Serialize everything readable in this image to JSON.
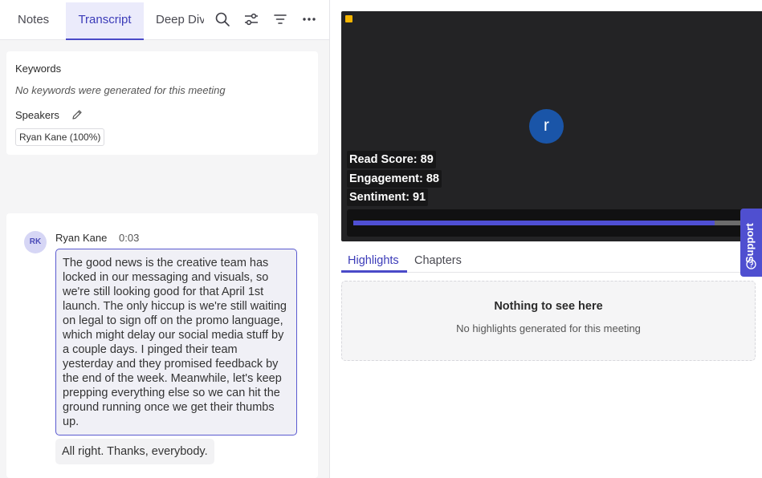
{
  "tabs": {
    "notes": "Notes",
    "transcript": "Transcript",
    "deep_dive": "Deep Dive"
  },
  "toolbar_icons": [
    "search-icon",
    "sliders-icon",
    "filter-icon",
    "more-icon"
  ],
  "keywords": {
    "title": "Keywords",
    "empty": "No keywords were generated for this meeting"
  },
  "speakers": {
    "title": "Speakers",
    "chips": [
      "Ryan Kane (100%)"
    ]
  },
  "transcript": {
    "initials": "RK",
    "speaker": "Ryan Kane",
    "time": "0:03",
    "segment1": "The good news is the creative team has locked in our messaging and visuals, so we're still looking good for that April 1st launch. The only hiccup is we're still waiting on legal to sign off on the promo language, which might delay our social media stuff by a couple days. I pinged their team yesterday and they promised feedback by the end of the week. Meanwhile, let's keep prepping everything else so we can hit the ground running once we get their thumbs up.",
    "segment2": "All right. Thanks, everybody."
  },
  "video": {
    "avatar_letter": "r",
    "read_score": "Read Score: 89",
    "engagement": "Engagement: 88",
    "sentiment": "Sentiment: 91",
    "progress": 0.87
  },
  "highlights": {
    "tab_highlights": "Highlights",
    "tab_chapters": "Chapters",
    "empty_title": "Nothing to see here",
    "empty_sub": "No highlights generated for this meeting"
  },
  "support": {
    "label": "Support"
  },
  "colors": {
    "accent": "#4a4ac8",
    "support_bg": "#4f4fd0",
    "video_bg": "#232325",
    "avatar_bg": "#1a55a8"
  }
}
